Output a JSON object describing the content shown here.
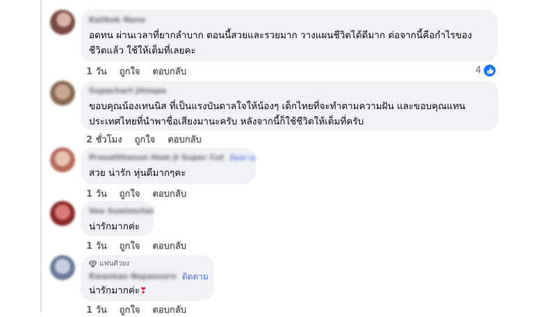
{
  "comments": [
    {
      "author": "Kalikok Nana",
      "text_lines": [
        "อดทน ผ่านเวลาที่ยากลำบาก ตอนนี้สวยและรวยมาก วางแผนชีวิตได้ดีมาก ต่อจากนี้คือกำไรของ",
        "ชีวิตแล้ว ใช้ให้เต็มที่เลยคะ"
      ],
      "time": "1 วัน",
      "like_label": "ถูกใจ",
      "reply_label": "ตอบกลับ",
      "reaction_count": "4",
      "avatar_colors": [
        "#7a4a44",
        "#d9b3a8"
      ]
    },
    {
      "author": "Supachart Jitnopa",
      "text_lines": [
        "ขอบคุณน้องเทนนิส ที่เป็นแรงบันดาลใจให้น้องๆ เด็กไทยที่จะทำตามความฝัน และขอบคุณแทน",
        "ประเทศไทยที่นำพาชื่อเสียงมานะครับ หลังจากนี้ก็ใช้ชีวิตให้เต็มที่ครับ"
      ],
      "time": "2 ชั่วโมง",
      "like_label": "ถูกใจ",
      "reply_label": "ตอบกลับ",
      "avatar_colors": [
        "#8a6a55",
        "#c9a78e"
      ]
    },
    {
      "author": "Pranatthanun Hom Ji Super Cut",
      "follow_label": "ติดตาม",
      "text_lines": [
        "สวย น่ารัก หุ่นดีมากๆคะ"
      ],
      "time": "1 วัน",
      "like_label": "ถูกใจ",
      "reply_label": "ตอบกลับ",
      "avatar_colors": [
        "#b86a5a",
        "#e9c4b4"
      ]
    },
    {
      "author": "Vee Suwimchai",
      "text_lines": [
        "น่ารักมากค่ะ"
      ],
      "time": "1 วัน",
      "like_label": "ถูกใจ",
      "reply_label": "ตอบกลับ",
      "avatar_colors": [
        "#8a2a2a",
        "#d97a7a"
      ]
    },
    {
      "fan_badge": "แฟนตัวยง",
      "author": "Kwankao Napassorn",
      "follow_label": "ติดตาม",
      "text_lines": [
        "น่ารักมากค่ะ"
      ],
      "emoji": "❣",
      "time": "1 วัน",
      "like_label": "ถูกใจ",
      "reply_label": "ตอบกลับ",
      "avatar_colors": [
        "#6a7a9a",
        "#c8cfe0"
      ]
    }
  ],
  "colors": {
    "bubble_bg": "#f0f2f5",
    "meta_text": "#65676b",
    "like_blue": "#1877f2",
    "heart_red": "#e41e3f"
  }
}
